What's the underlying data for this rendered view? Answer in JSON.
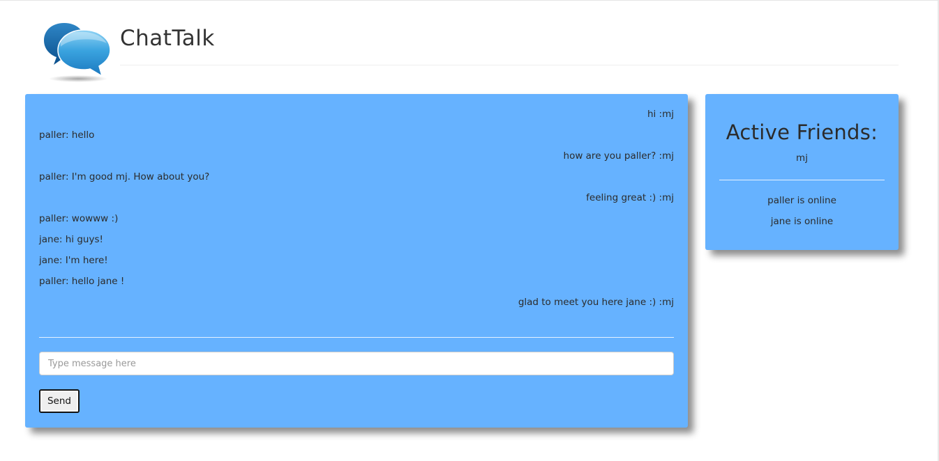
{
  "app": {
    "title": "ChatTalk",
    "logo_icon": "speech-bubbles-icon"
  },
  "chat": {
    "messages": [
      {
        "side": "mine",
        "text": "hi :mj"
      },
      {
        "side": "theirs",
        "text": "paller: hello"
      },
      {
        "side": "mine",
        "text": "how are you paller? :mj"
      },
      {
        "side": "theirs",
        "text": "paller: I'm good mj. How about you?"
      },
      {
        "side": "mine",
        "text": "feeling great :) :mj"
      },
      {
        "side": "theirs",
        "text": "paller: wowww :)"
      },
      {
        "side": "theirs",
        "text": "jane: hi guys!"
      },
      {
        "side": "theirs",
        "text": "jane: I'm here!"
      },
      {
        "side": "theirs",
        "text": "paller: hello jane !"
      },
      {
        "side": "mine",
        "text": "glad to meet you here jane :) :mj"
      }
    ],
    "input": {
      "placeholder": "Type message here",
      "value": ""
    },
    "send_label": "Send"
  },
  "friends": {
    "title": "Active Friends:",
    "current_user": "mj",
    "online": [
      {
        "text": "paller is online"
      },
      {
        "text": "jane is online"
      }
    ]
  },
  "colors": {
    "panel": "#66b2ff",
    "logo_dark": "#0d5fa3",
    "logo_light": "#3fa2e0"
  }
}
